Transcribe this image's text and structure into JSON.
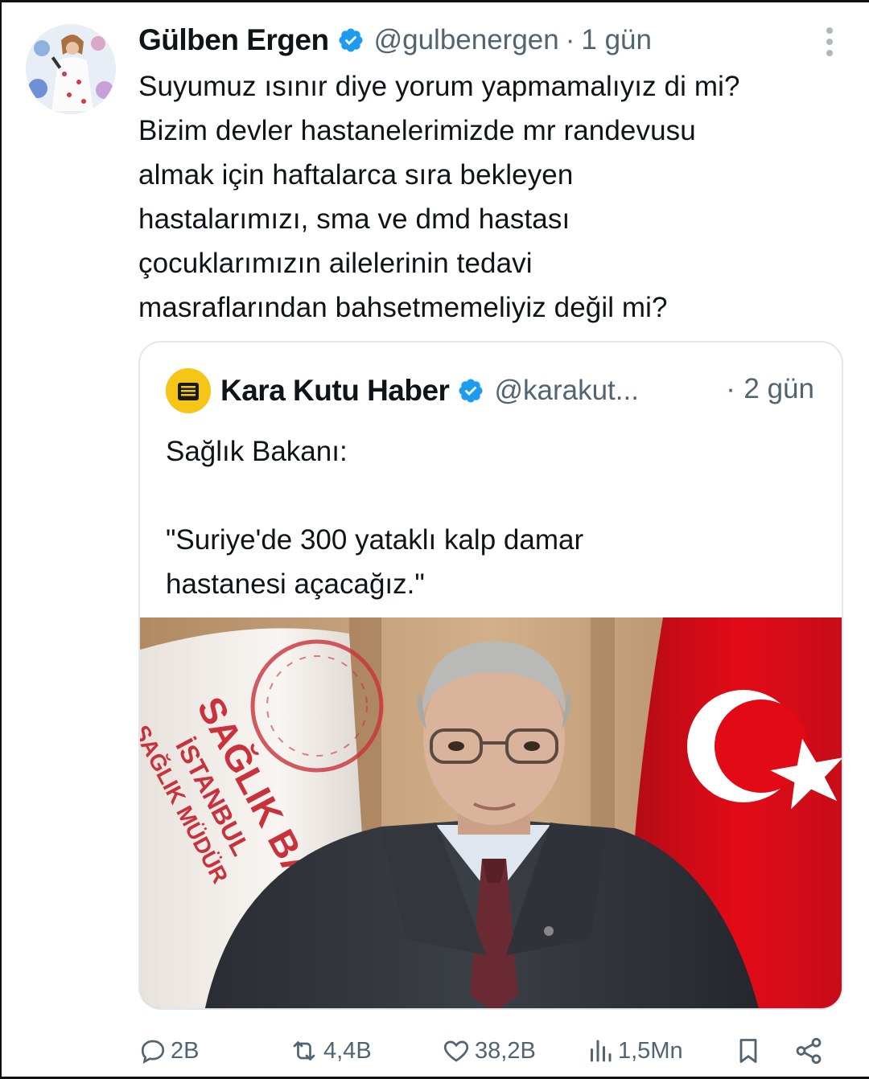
{
  "tweet": {
    "author_name": "Gülben Ergen",
    "author_handle": "@gulbenergen",
    "separator": "·",
    "time": "1 gün",
    "text_lines": [
      "Suyumuz ısınır diye yorum yapmamalıyız di mi?",
      "Bizim devler hastanelerimizde mr randevusu",
      "almak için haftalarca sıra bekleyen",
      "hastalarımızı, sma ve dmd hastası",
      "çocuklarımızın ailelerinin tedavi",
      "masraflarından bahsetmemeliyiz değil mi?"
    ]
  },
  "quoted_tweet": {
    "author_name": "Kara Kutu Haber",
    "author_handle": "@karakut...",
    "separator": "·",
    "time": "2 gün",
    "text_lines": [
      "Sağlık Bakanı:",
      "",
      "\"Suriye'de 300 yataklı kalp damar",
      "hastanesi açacağız.\""
    ],
    "image": {
      "flag_text_lines": [
        "SAĞLIK BA",
        "İSTANBUL",
        "SAĞLIK MÜDÜR"
      ]
    }
  },
  "actions": {
    "replies": "2B",
    "reposts": "4,4B",
    "likes": "38,2B",
    "views": "1,5Mn"
  },
  "colors": {
    "verified": "#1d9bf0",
    "secondary_text": "#536471",
    "quote_logo": "#f5c518",
    "flag_red": "#e30a17"
  },
  "icons": [
    "more-icon",
    "verified-badge-icon",
    "reply-icon",
    "repost-icon",
    "like-icon",
    "views-icon",
    "bookmark-icon",
    "share-icon"
  ]
}
